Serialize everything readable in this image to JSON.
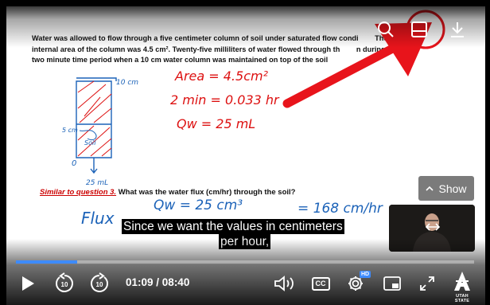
{
  "problem": {
    "line1": "Water was allowed to flow through a five centimeter column of soil under saturated flow condi",
    "line1_tail": "The",
    "line2": "internal area of the column was 4.5 cm². Twenty-five milliliters of water flowed through th",
    "line2_tail": "n during a",
    "line3": "two minute time period when a 10 cm water column was maintained on top of the soil"
  },
  "annotations": {
    "area": "Area = 4.5cm²",
    "time": "2 min = 0.033 hr",
    "qw": "Qw = 25 mL",
    "ten_cm": "10 cm",
    "five_cm": "5 cm",
    "soil": "Soil",
    "out": "25 mL",
    "flux": "Flux",
    "qw_frac": "Qw = 25 cm³",
    "result": "= 168 cm/hr"
  },
  "question": {
    "similar": "Similar to question 3.",
    "text": " What was the water flux (cm/hr) through the soil?"
  },
  "captions": {
    "line1": "Since we want the values in centimeters",
    "line2": "per hour,"
  },
  "show_button": {
    "label": "Show",
    "icon": "chevron-up-icon"
  },
  "player": {
    "current_time": "01:09",
    "separator": " / ",
    "duration": "08:40",
    "progress": 0.133,
    "skip_back": "10",
    "skip_forward": "10",
    "hd_label": "HD",
    "cc_label": "CC",
    "brand_label": "UTAH STATE",
    "accent": "#3d8bff"
  },
  "colors": {
    "red_ink": "#dd1111",
    "blue_ink": "#1b62b8",
    "arrow_red": "#e8141b"
  }
}
